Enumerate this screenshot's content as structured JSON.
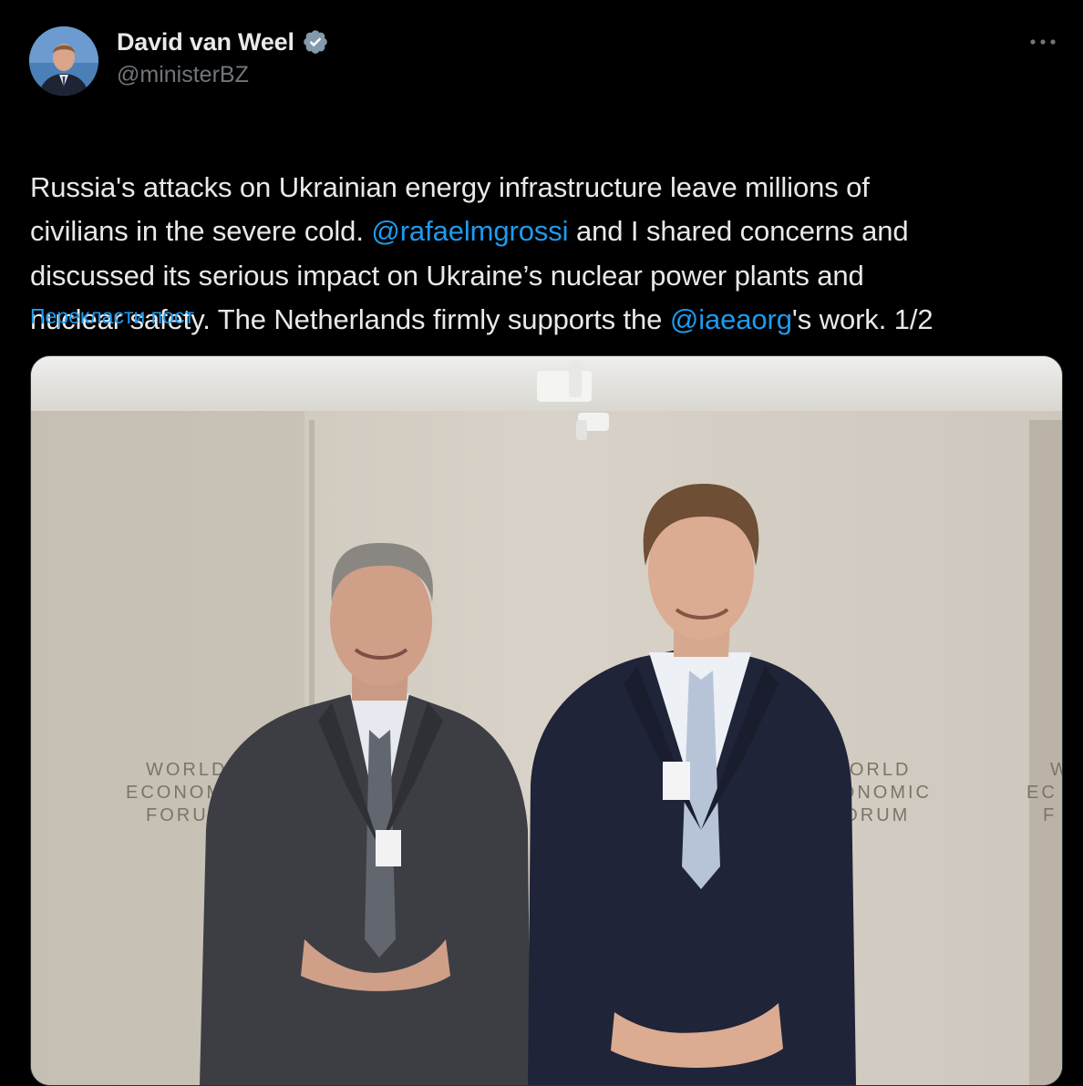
{
  "author": {
    "name": "David van Weel",
    "handle": "@ministerBZ",
    "verified": true,
    "avatar_icon": "avatar-photo"
  },
  "more_icon": "more-horizontal-icon",
  "tweet": {
    "segments": [
      {
        "text": "Russia's attacks on Ukrainian energy infrastructure leave millions of\ncivilians in the severe cold. ",
        "type": "text"
      },
      {
        "text": "@rafaelmgrossi",
        "type": "mention"
      },
      {
        "text": " and I shared concerns and\ndiscussed its serious impact on Ukraine’s nuclear power plants and\nnuclear safety. The Netherlands firmly supports the ",
        "type": "text"
      },
      {
        "text": "@iaeaorg",
        "type": "mention"
      },
      {
        "text": "'s work. 1/2",
        "type": "text"
      }
    ]
  },
  "translate_label": "Перекласти пост",
  "media": {
    "backdrop_logo_left": [
      "WORLD",
      "ECONOMIC",
      "FORUM"
    ],
    "backdrop_logo_mid": [
      "WORLD",
      "ECONOMIC",
      "FORUM"
    ],
    "backdrop_logo_right": [
      "W",
      "EC",
      "F"
    ]
  },
  "colors": {
    "background": "#000000",
    "text": "#e7e9ea",
    "secondary": "#71767b",
    "link": "#1d9bf0"
  }
}
